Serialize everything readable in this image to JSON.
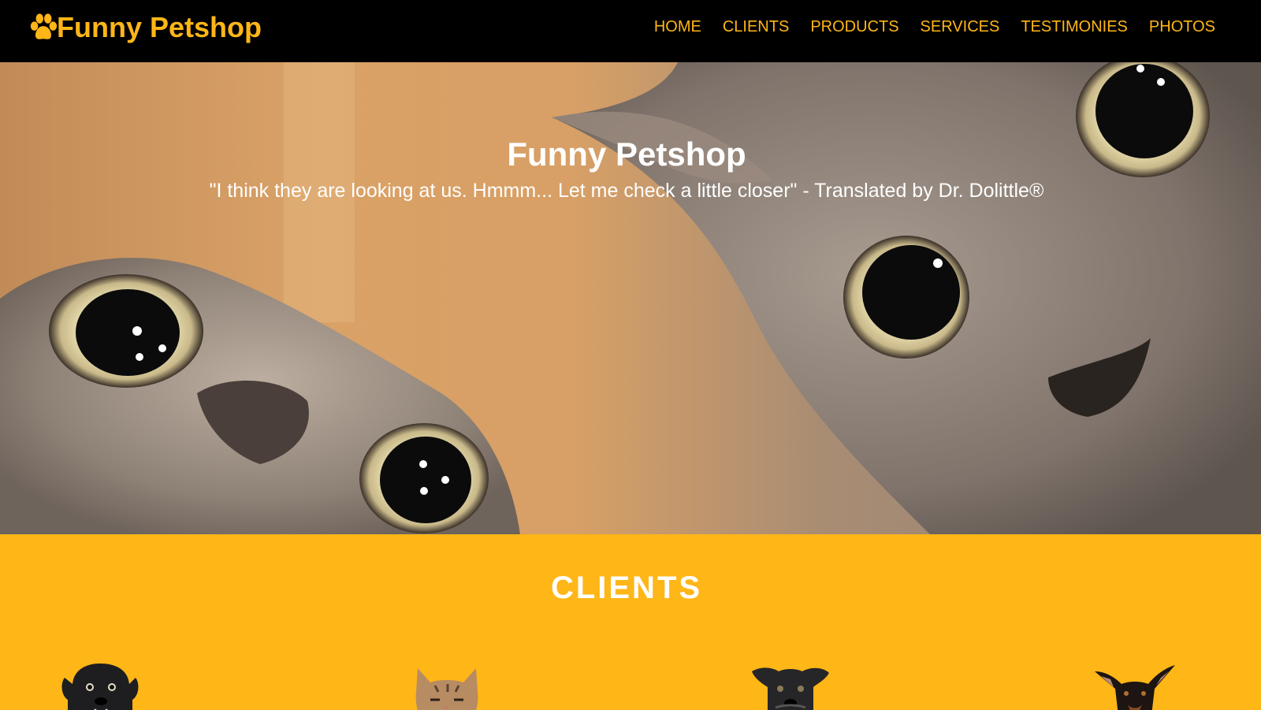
{
  "brand": {
    "name": "Funny Petshop",
    "icon": "paw-icon",
    "color": "#ffb617"
  },
  "nav": {
    "items": [
      {
        "label": "HOME"
      },
      {
        "label": "CLIENTS"
      },
      {
        "label": "PRODUCTS"
      },
      {
        "label": "SERVICES"
      },
      {
        "label": "TESTIMONIES"
      },
      {
        "label": "PHOTOS"
      }
    ]
  },
  "hero": {
    "title": "Funny Petshop",
    "quote": "\"I think they are looking at us. Hmmm... Let me check a little closer\" - Translated by Dr. Dolittle®"
  },
  "clients": {
    "title": "CLIENTS",
    "background": "#ffb617",
    "items": [
      {
        "icon": "black-dog-icon"
      },
      {
        "icon": "tabby-cat-icon"
      },
      {
        "icon": "dark-dog-icon"
      },
      {
        "icon": "doberman-dog-icon"
      }
    ]
  },
  "colors": {
    "accent": "#ffb617",
    "navbar": "#000000",
    "text_light": "#ffffff"
  }
}
